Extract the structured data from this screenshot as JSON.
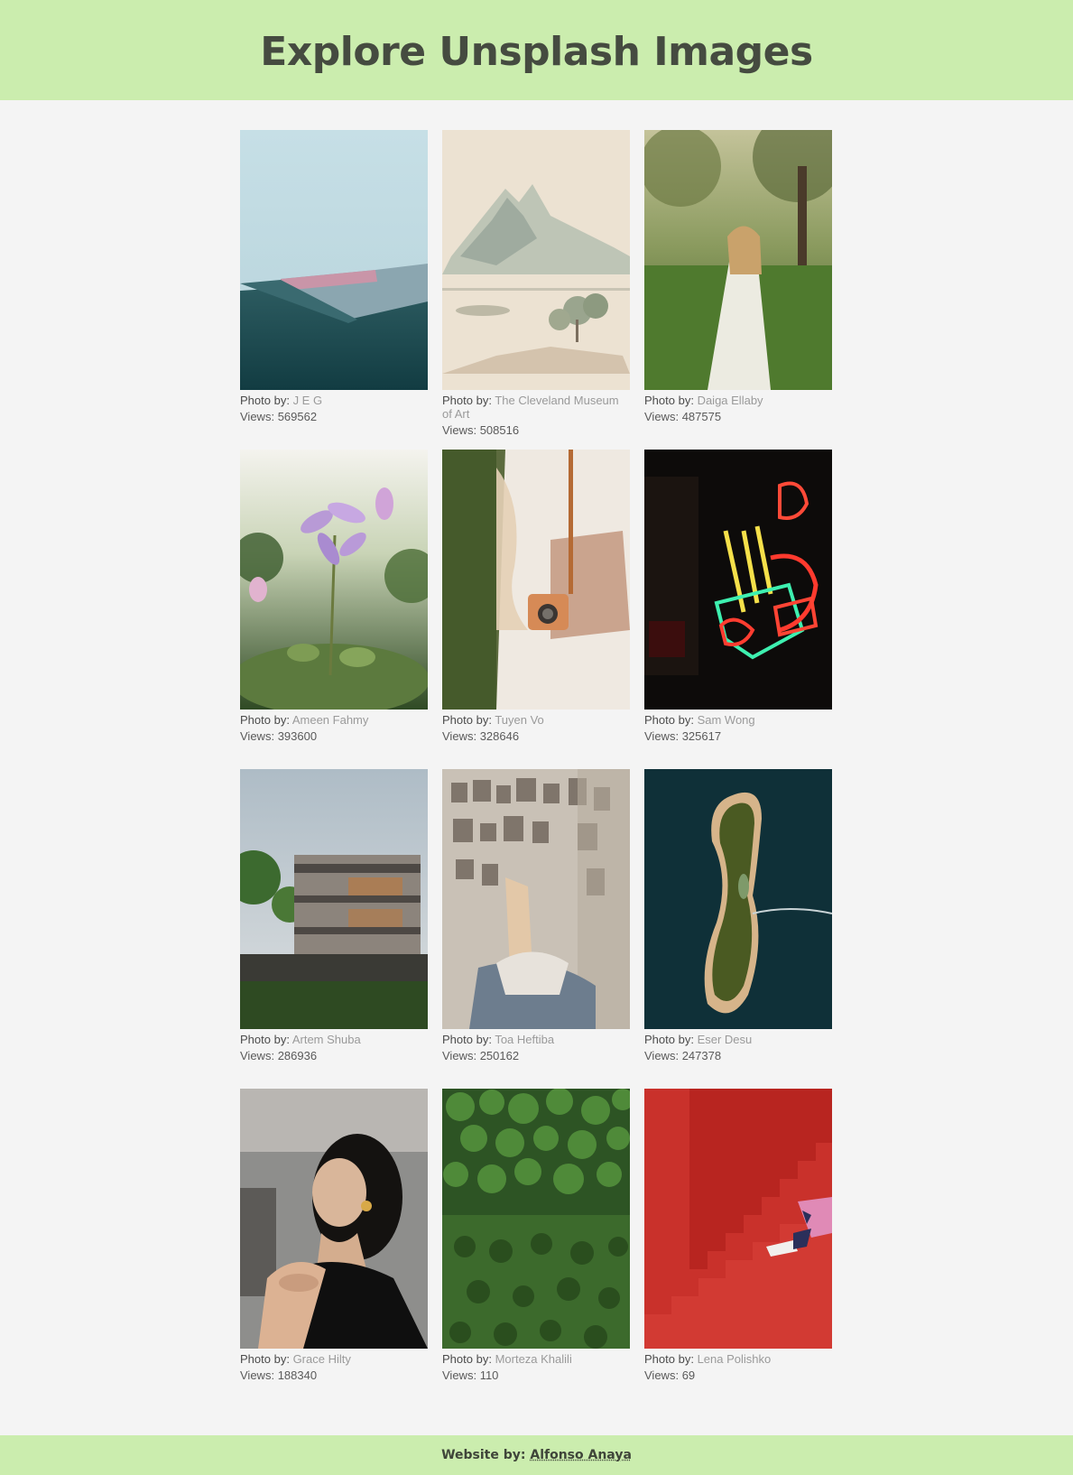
{
  "page": {
    "title": "Explore Unsplash Images"
  },
  "photos": [
    {
      "label": "Photo by:",
      "author": "J E G",
      "views_label": "Views:",
      "views": "569562",
      "icon": "photo-icon"
    },
    {
      "label": "Photo by:",
      "author": "The Cleveland Museum of Art",
      "views_label": "Views:",
      "views": "508516",
      "icon": "photo-icon"
    },
    {
      "label": "Photo by:",
      "author": "Daiga Ellaby",
      "views_label": "Views:",
      "views": "487575",
      "icon": "photo-icon"
    },
    {
      "label": "Photo by:",
      "author": "Ameen Fahmy",
      "views_label": "Views:",
      "views": "393600",
      "icon": "photo-icon"
    },
    {
      "label": "Photo by:",
      "author": "Tuyen Vo",
      "views_label": "Views:",
      "views": "328646",
      "icon": "photo-icon"
    },
    {
      "label": "Photo by:",
      "author": "Sam Wong",
      "views_label": "Views:",
      "views": "325617",
      "icon": "photo-icon"
    },
    {
      "label": "Photo by:",
      "author": "Artem Shuba",
      "views_label": "Views:",
      "views": "286936",
      "icon": "photo-icon"
    },
    {
      "label": "Photo by:",
      "author": "Toa Heftiba",
      "views_label": "Views:",
      "views": "250162",
      "icon": "photo-icon"
    },
    {
      "label": "Photo by:",
      "author": "Eser Desu",
      "views_label": "Views:",
      "views": "247378",
      "icon": "photo-icon"
    },
    {
      "label": "Photo by:",
      "author": "Grace Hilty",
      "views_label": "Views:",
      "views": "188340",
      "icon": "photo-icon"
    },
    {
      "label": "Photo by:",
      "author": "Morteza Khalili",
      "views_label": "Views:",
      "views": "110",
      "icon": "photo-icon"
    },
    {
      "label": "Photo by:",
      "author": "Lena Polishko",
      "views_label": "Views:",
      "views": "69",
      "icon": "photo-icon"
    }
  ],
  "footer": {
    "label": "Website by:",
    "author": "Alfonso Anaya"
  },
  "colors": {
    "header_bg": "#cbedae",
    "page_bg": "#f4f4f4",
    "title": "#454b40",
    "author_text": "#9a9a9a"
  }
}
